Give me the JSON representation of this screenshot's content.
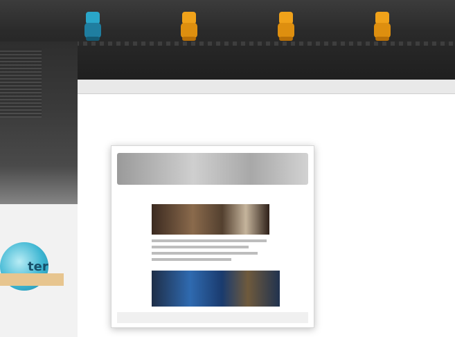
{
  "nav": {
    "items": [
      {
        "label": "",
        "color": "#2aa6c9"
      },
      {
        "label": "",
        "color": "#f0a21a"
      },
      {
        "label": "",
        "color": "#f0a21a"
      },
      {
        "label": "",
        "color": "#f0a21a"
      }
    ]
  },
  "headline": "",
  "badge": {
    "text": "ter"
  },
  "right_column": {
    "title": "",
    "subtitle": "",
    "paragraph": ""
  }
}
